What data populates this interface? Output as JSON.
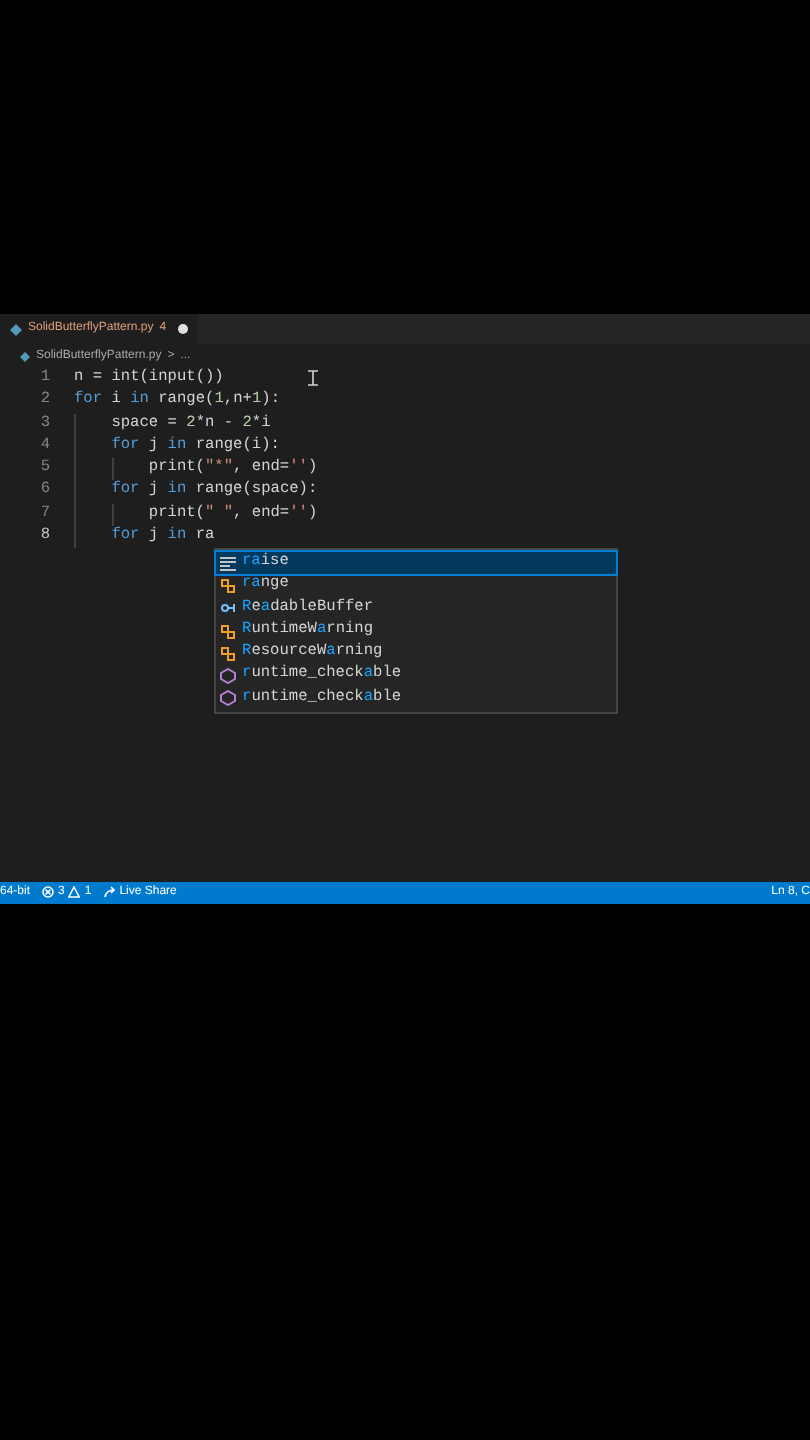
{
  "tab": {
    "filename": "SolidButterflyPattern.py",
    "problem_count": "4",
    "modified": true,
    "selected": true
  },
  "breadcrumb": {
    "file": "SolidButterflyPattern.py",
    "separator": ">",
    "more": "..."
  },
  "code_lines": [
    {
      "number": "1",
      "current": false,
      "tokens": [
        {
          "kind": "plain",
          "text": "n = int(input())"
        }
      ]
    },
    {
      "number": "2",
      "current": false,
      "tokens": [
        {
          "kind": "keyword",
          "text": "for"
        },
        {
          "kind": "plain",
          "text": " i "
        },
        {
          "kind": "keyword",
          "text": "in"
        },
        {
          "kind": "plain",
          "text": " range("
        },
        {
          "kind": "number",
          "text": "1"
        },
        {
          "kind": "plain",
          "text": ",n+"
        },
        {
          "kind": "number",
          "text": "1"
        },
        {
          "kind": "plain",
          "text": "):"
        }
      ],
      "children": [
        {
          "number": "3",
          "current": false,
          "tokens": [
            {
              "kind": "plain",
              "text": "space = "
            },
            {
              "kind": "number",
              "text": "2"
            },
            {
              "kind": "plain",
              "text": "*n - "
            },
            {
              "kind": "number",
              "text": "2"
            },
            {
              "kind": "plain",
              "text": "*i"
            }
          ]
        },
        {
          "number": "4",
          "current": false,
          "tokens": [
            {
              "kind": "keyword",
              "text": "for"
            },
            {
              "kind": "plain",
              "text": " j "
            },
            {
              "kind": "keyword",
              "text": "in"
            },
            {
              "kind": "plain",
              "text": " range(i):"
            }
          ],
          "children": [
            {
              "number": "5",
              "current": false,
              "tokens": [
                {
                  "kind": "plain",
                  "text": "print("
                },
                {
                  "kind": "string",
                  "text": "\"*\""
                },
                {
                  "kind": "plain",
                  "text": ", end="
                },
                {
                  "kind": "string",
                  "text": "''"
                },
                {
                  "kind": "plain",
                  "text": ")"
                }
              ]
            }
          ]
        },
        {
          "number": "6",
          "current": false,
          "tokens": [
            {
              "kind": "keyword",
              "text": "for"
            },
            {
              "kind": "plain",
              "text": " j "
            },
            {
              "kind": "keyword",
              "text": "in"
            },
            {
              "kind": "plain",
              "text": " range(space):"
            }
          ],
          "children": [
            {
              "number": "7",
              "current": false,
              "tokens": [
                {
                  "kind": "plain",
                  "text": "print("
                },
                {
                  "kind": "string",
                  "text": "\" \""
                },
                {
                  "kind": "plain",
                  "text": ", end="
                },
                {
                  "kind": "string",
                  "text": "''"
                },
                {
                  "kind": "plain",
                  "text": ")"
                }
              ]
            }
          ]
        },
        {
          "number": "8",
          "current": true,
          "tokens": [
            {
              "kind": "keyword",
              "text": "for"
            },
            {
              "kind": "plain",
              "text": " j "
            },
            {
              "kind": "keyword",
              "text": "in"
            },
            {
              "kind": "plain",
              "text": " ra"
            }
          ]
        }
      ]
    }
  ],
  "suggestions": [
    {
      "kind": "keyword",
      "selected": true,
      "parts": [
        {
          "text": "ra",
          "match": true
        },
        {
          "text": "ise",
          "match": false
        }
      ]
    },
    {
      "kind": "class",
      "selected": false,
      "parts": [
        {
          "text": "ra",
          "match": true
        },
        {
          "text": "nge",
          "match": false
        }
      ]
    },
    {
      "kind": "interface",
      "selected": false,
      "parts": [
        {
          "text": "R",
          "match": true
        },
        {
          "text": "e",
          "match": false
        },
        {
          "text": "a",
          "match": true
        },
        {
          "text": "dableBuffer",
          "match": false
        }
      ]
    },
    {
      "kind": "class",
      "selected": false,
      "parts": [
        {
          "text": "R",
          "match": true
        },
        {
          "text": "untimeW",
          "match": false
        },
        {
          "text": "a",
          "match": true
        },
        {
          "text": "rning",
          "match": false
        }
      ]
    },
    {
      "kind": "class",
      "selected": false,
      "parts": [
        {
          "text": "R",
          "match": true
        },
        {
          "text": "esourceW",
          "match": false
        },
        {
          "text": "a",
          "match": true
        },
        {
          "text": "rning",
          "match": false
        }
      ]
    },
    {
      "kind": "function",
      "selected": false,
      "parts": [
        {
          "text": "r",
          "match": true
        },
        {
          "text": "untime_check",
          "match": false
        },
        {
          "text": "a",
          "match": true
        },
        {
          "text": "ble",
          "match": false
        }
      ]
    },
    {
      "kind": "function",
      "selected": false,
      "parts": [
        {
          "text": "r",
          "match": true
        },
        {
          "text": "untime_check",
          "match": false
        },
        {
          "text": "a",
          "match": true
        },
        {
          "text": "ble",
          "match": false
        }
      ]
    }
  ],
  "status_bar": {
    "interpreter": "64-bit",
    "errors": "3",
    "warnings": "1",
    "live_share": "Live Share",
    "position": "Ln 8, C"
  }
}
